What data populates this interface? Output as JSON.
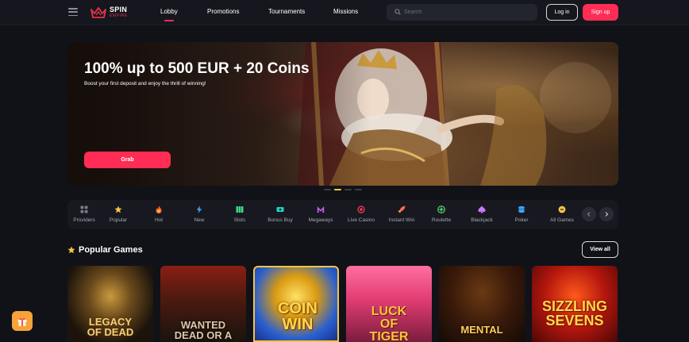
{
  "header": {
    "logo": {
      "line1": "SPIN",
      "line2": "EMPIRE"
    },
    "nav": [
      {
        "label": "Lobby",
        "active": true
      },
      {
        "label": "Promotions"
      },
      {
        "label": "Tournaments"
      },
      {
        "label": "Missions"
      }
    ],
    "search_placeholder": "Search",
    "login_label": "Log in",
    "signup_label": "Sign up"
  },
  "banner": {
    "title": "100% up to 500 EUR + 20 Coins",
    "subtitle": "Boost your first deposit and enjoy the thrill of winning!",
    "cta_label": "Grab",
    "slides_count": 4,
    "active_slide": 2
  },
  "categories": [
    {
      "label": "Providers",
      "icon": "grid-icon"
    },
    {
      "label": "Popular",
      "icon": "star-icon"
    },
    {
      "label": "Hot",
      "icon": "flame-icon"
    },
    {
      "label": "New",
      "icon": "bolt-icon"
    },
    {
      "label": "Slots",
      "icon": "slots-icon"
    },
    {
      "label": "Bonus Buy",
      "icon": "ticket-icon"
    },
    {
      "label": "Megaways",
      "icon": "megaways-icon"
    },
    {
      "label": "Live Casino",
      "icon": "live-icon"
    },
    {
      "label": "Instant Win",
      "icon": "rocket-icon"
    },
    {
      "label": "Roulette",
      "icon": "roulette-icon"
    },
    {
      "label": "Blackjack",
      "icon": "spade-icon"
    },
    {
      "label": "Poker",
      "icon": "chips-icon"
    },
    {
      "label": "All Games",
      "icon": "all-games-icon"
    }
  ],
  "popular": {
    "title": "Popular Games",
    "view_all_label": "View all",
    "games": [
      {
        "title": "LEGACY\nOF DEAD"
      },
      {
        "title": "WANTED\nDEAD OR A WILD"
      },
      {
        "title": "COIN\nWIN"
      },
      {
        "title": "LUCK\nOF\nTIGER"
      },
      {
        "title": "MENTAL"
      },
      {
        "title": "SIZZLING\nSEVENS"
      }
    ]
  },
  "colors": {
    "accent": "#ff2d55",
    "background": "#111218",
    "panel": "#181920",
    "active_dot": "#ffcc33"
  }
}
